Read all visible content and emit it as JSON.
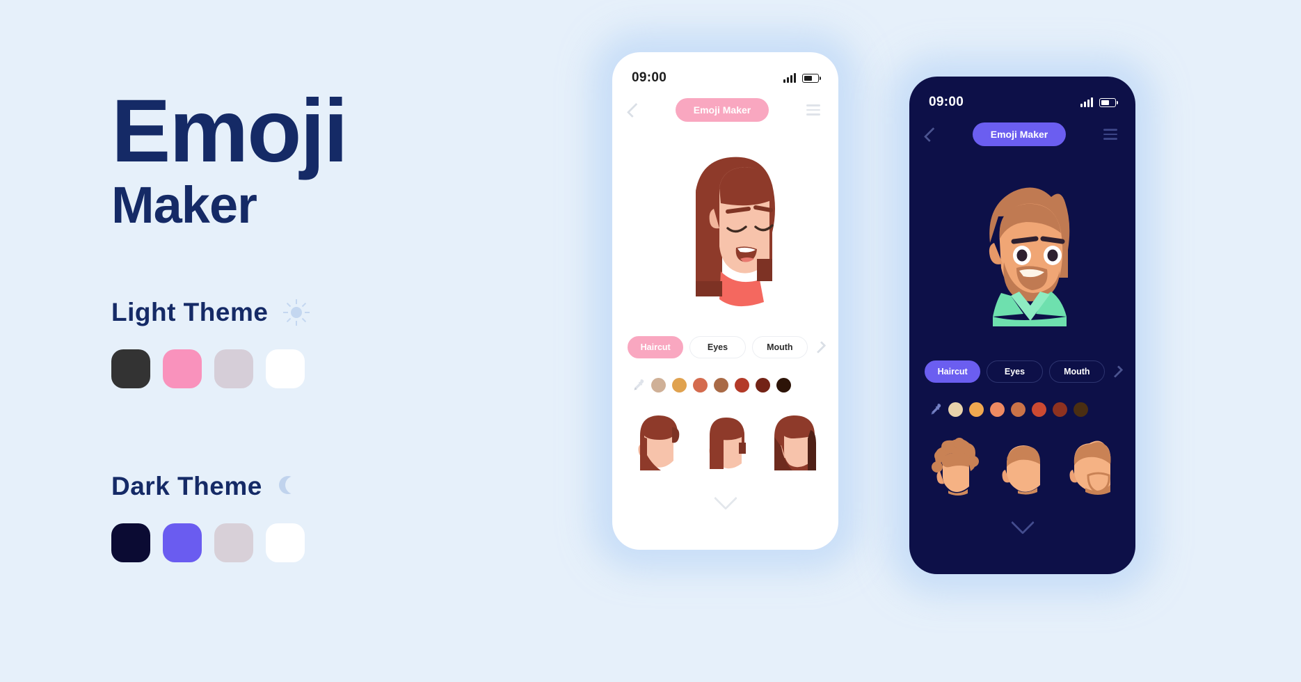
{
  "page": {
    "background_color": "#e6f0fa",
    "title_line1": "Emoji",
    "title_line2": "Maker",
    "title_color": "#152a66"
  },
  "themes": [
    {
      "id": "light",
      "label": "Light Theme",
      "icon": "sun-icon",
      "swatches": [
        "#333333",
        "#f992bc",
        "#d6ced8",
        "#ffffff"
      ]
    },
    {
      "id": "dark",
      "label": "Dark Theme",
      "icon": "moon-icon",
      "swatches": [
        "#0b0b33",
        "#6a5cf0",
        "#d8d0d8",
        "#ffffff"
      ]
    }
  ],
  "phones": [
    {
      "id": "light-phone",
      "theme": "light",
      "screen_bg": "#ffffff",
      "accent": "#f9a7c0",
      "statusbar": {
        "time": "09:00",
        "signal_icon": "signal-bars-icon",
        "battery_icon": "battery-icon",
        "battery_level": "62%"
      },
      "appbar": {
        "back_icon": "chevron-left-icon",
        "title": "Emoji Maker",
        "menu_icon": "hamburger-menu-icon"
      },
      "avatar": {
        "name": "female-avatar-preview",
        "hair_color": "#8e3a2a",
        "skin_color": "#f7c3ab",
        "shirt_color": "#f4685f"
      },
      "tabs": [
        {
          "label": "Haircut",
          "active": true
        },
        {
          "label": "Eyes",
          "active": false
        },
        {
          "label": "Mouth",
          "active": false
        }
      ],
      "tabs_next_icon": "chevron-right-icon",
      "palette": {
        "dropper_icon": "eyedropper-icon",
        "colors": [
          "#cfb097",
          "#e0a24f",
          "#d46b4e",
          "#a96a46",
          "#b33a28",
          "#732316",
          "#2d1408"
        ]
      },
      "thumbnails": [
        {
          "name": "haircut-thumb-1",
          "style": "long-side-part"
        },
        {
          "name": "haircut-thumb-2",
          "style": "bob-with-bangs"
        },
        {
          "name": "haircut-thumb-3",
          "style": "long-straight"
        }
      ],
      "expand_icon": "chevron-down-icon"
    },
    {
      "id": "dark-phone",
      "theme": "dark",
      "screen_bg": "#0d1048",
      "accent": "#6b5ef0",
      "statusbar": {
        "time": "09:00",
        "signal_icon": "signal-bars-icon",
        "battery_icon": "battery-icon",
        "battery_level": "62%"
      },
      "appbar": {
        "back_icon": "chevron-left-icon",
        "title": "Emoji Maker",
        "menu_icon": "hamburger-menu-icon"
      },
      "avatar": {
        "name": "male-avatar-preview",
        "hair_color": "#c07a52",
        "skin_color": "#f0a675",
        "shirt_color": "#6ee0ae"
      },
      "tabs": [
        {
          "label": "Haircut",
          "active": true
        },
        {
          "label": "Eyes",
          "active": false
        },
        {
          "label": "Mouth",
          "active": false
        }
      ],
      "tabs_next_icon": "chevron-right-icon",
      "palette": {
        "dropper_icon": "eyedropper-icon",
        "colors": [
          "#e8d2ab",
          "#f0a850",
          "#ee8a62",
          "#cb7348",
          "#cc4a32",
          "#8e3220",
          "#4a2e12"
        ]
      },
      "thumbnails": [
        {
          "name": "haircut-thumb-1",
          "style": "curly-afro"
        },
        {
          "name": "haircut-thumb-2",
          "style": "short-crop"
        },
        {
          "name": "haircut-thumb-3",
          "style": "beard-style"
        }
      ],
      "expand_icon": "chevron-down-icon"
    }
  ]
}
